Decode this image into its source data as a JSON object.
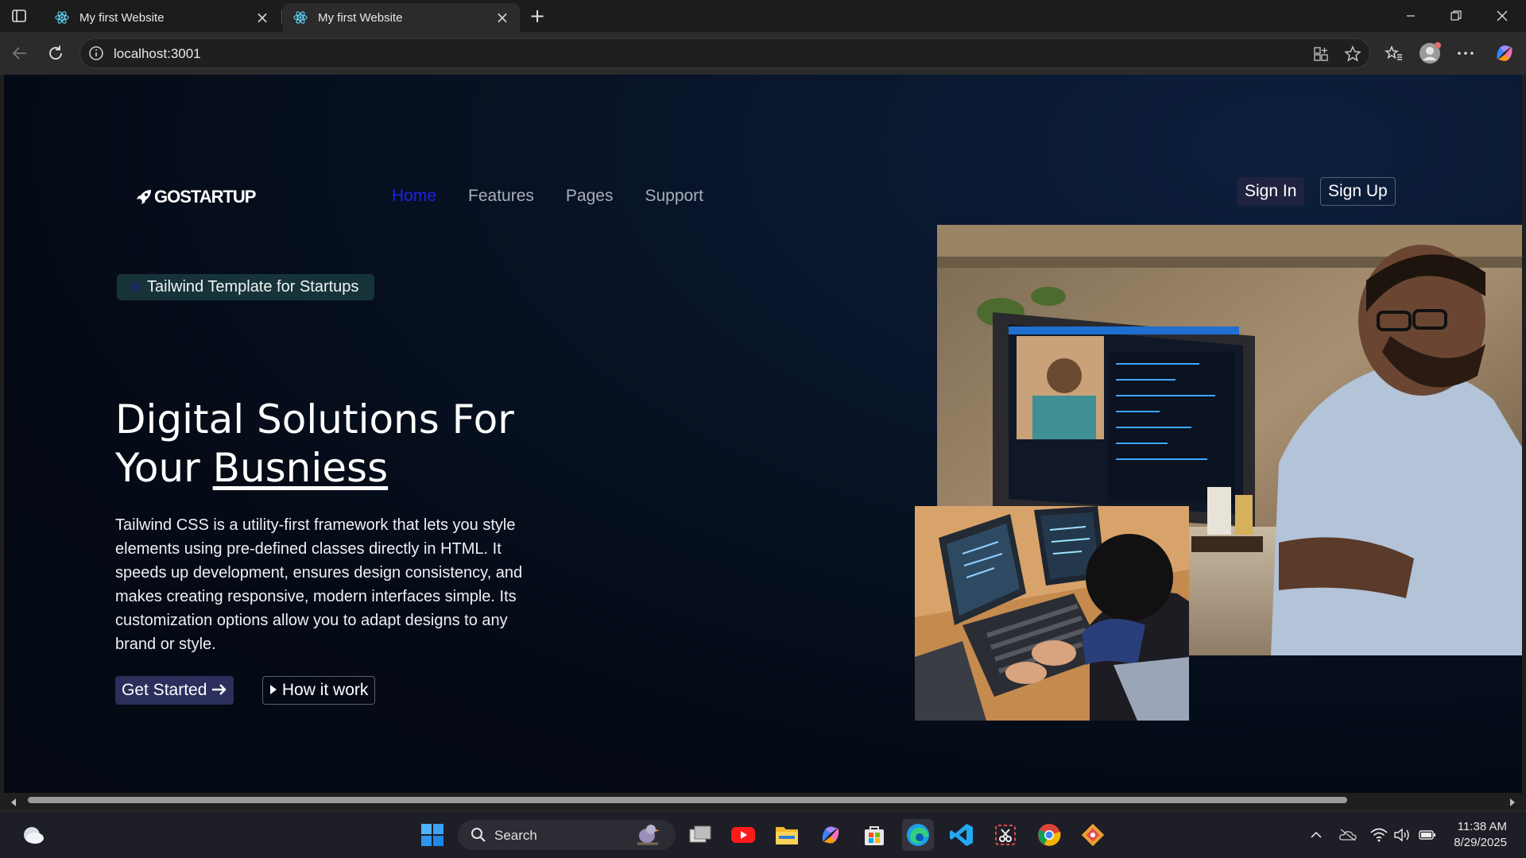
{
  "browser": {
    "tabs": [
      {
        "title": "My first Website",
        "active": false
      },
      {
        "title": "My first Website",
        "active": true
      }
    ],
    "address": "localhost:3001"
  },
  "site": {
    "logo_text": "GOSTARTUP",
    "nav": {
      "home": "Home",
      "features": "Features",
      "pages": "Pages",
      "support": "Support"
    },
    "sign_in": "Sign In",
    "sign_up": "Sign Up",
    "badge": "Tailwind Template for Startups",
    "hero": {
      "title_line1": "Digital Solutions For",
      "title_line2_prefix": "Your ",
      "title_line2_emph": "Busniess",
      "text": "Tailwind CSS is a utility-first framework that lets you style elements using pre-defined classes directly in HTML. It speeds up development, ensures design consistency, and makes creating responsive, modern interfaces simple. Its customization options allow you to adapt designs to any brand or style.",
      "cta_primary": "Get Started",
      "cta_secondary": "How it work"
    },
    "colors": {
      "active_nav": "#1d22e6",
      "background": "#050b16",
      "badge_bg": "#17333a"
    }
  },
  "taskbar": {
    "search_label": "Search",
    "time": "11:38 AM",
    "date": "8/29/2025"
  }
}
